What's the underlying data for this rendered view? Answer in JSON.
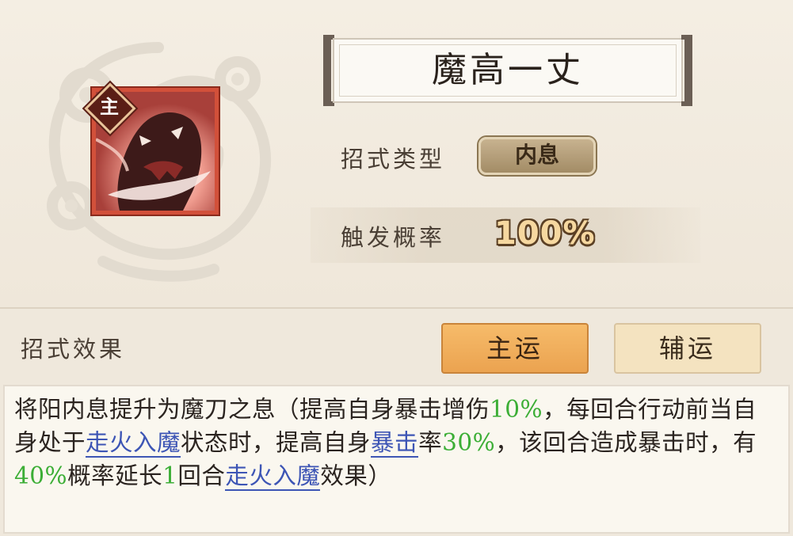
{
  "skill": {
    "badge": "主",
    "name": "魔高一丈"
  },
  "info": {
    "type_label": "招式类型",
    "type_value": "内息",
    "rate_label": "触发概率",
    "rate_value": "100%"
  },
  "effect": {
    "label": "招式效果",
    "tabs": [
      "主运",
      "辅运"
    ],
    "selected_tab": "主运",
    "description_segments": [
      {
        "text": "将阳内息提升为魔刀之息（提高自身暴击增伤",
        "style": "plain"
      },
      {
        "text": "10%",
        "style": "number"
      },
      {
        "text": "，每回合行动前当自身处于",
        "style": "plain"
      },
      {
        "text": "走火入魔",
        "style": "link"
      },
      {
        "text": "状态时，提高自身",
        "style": "plain"
      },
      {
        "text": "暴击",
        "style": "link"
      },
      {
        "text": "率",
        "style": "plain"
      },
      {
        "text": "30%",
        "style": "number"
      },
      {
        "text": "，该回合造成暴击时，有",
        "style": "plain"
      },
      {
        "text": "40%",
        "style": "number"
      },
      {
        "text": "概率延长",
        "style": "plain"
      },
      {
        "text": "1",
        "style": "number"
      },
      {
        "text": "回合",
        "style": "plain"
      },
      {
        "text": "走火入魔",
        "style": "link"
      },
      {
        "text": "效果）",
        "style": "plain"
      }
    ]
  },
  "colors": {
    "background": "#f0e9dc",
    "number_highlight": "#3cae36",
    "link_highlight": "#3d55b5",
    "main_tab": "#eba350",
    "aux_tab": "#f4e3c0",
    "icon_frame": "#d2503a"
  },
  "icons": [
    "cloud-pattern",
    "demon-skill-icon",
    "main-badge-diamond"
  ]
}
